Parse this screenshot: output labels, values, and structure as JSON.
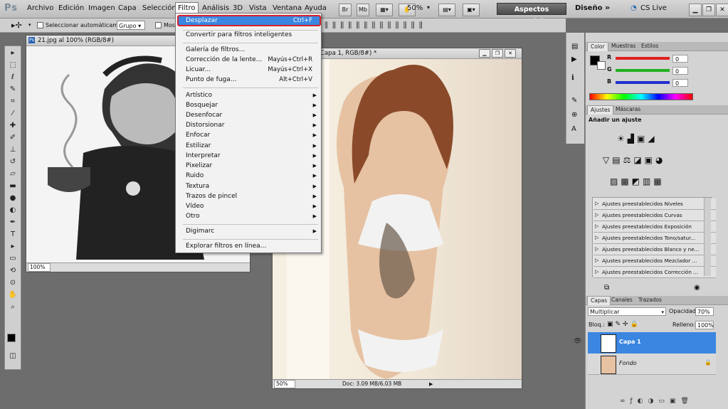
{
  "app": {
    "logo": "Ps"
  },
  "menubar": {
    "items": [
      "Archivo",
      "Edición",
      "Imagen",
      "Capa",
      "Selección",
      "Filtro",
      "Análisis",
      "3D",
      "Vista",
      "Ventana",
      "Ayuda"
    ],
    "zoom": "50%",
    "workspace": "Aspectos esenciales",
    "design": "Diseño",
    "cslive": "CS Live"
  },
  "options": {
    "auto_select_label": "Seleccionar automáticamente:",
    "auto_select_value": "Grupo",
    "show_label": "Mos"
  },
  "filter_menu": {
    "top": {
      "label": "Desplazar",
      "shortcut": "Ctrl+F"
    },
    "smart": "Convertir para filtros inteligentes",
    "group1": [
      {
        "label": "Galería de filtros...",
        "shortcut": ""
      },
      {
        "label": "Corrección de la lente...",
        "shortcut": "Mayús+Ctrl+R"
      },
      {
        "label": "Licuar...",
        "shortcut": "Mayús+Ctrl+X"
      },
      {
        "label": "Punto de fuga...",
        "shortcut": "Alt+Ctrl+V"
      }
    ],
    "submenus": [
      "Artístico",
      "Bosquejar",
      "Desenfocar",
      "Distorsionar",
      "Enfocar",
      "Estilizar",
      "Interpretar",
      "Pixelizar",
      "Ruido",
      "Textura",
      "Trazos de pincel",
      "Vídeo",
      "Otro"
    ],
    "digimarc": "Digimarc",
    "online": "Explorar filtros en línea..."
  },
  "doc1": {
    "title": "21.jpg al 100% (RGB/8#)",
    "zoom": "100%"
  },
  "doc2": {
    "title": "jpg al 50% (Capa 1, RGB/8#) *",
    "zoom": "50%",
    "status": "Doc: 3.09 MB/6.03 MB"
  },
  "color_panel": {
    "tabs": [
      "Color",
      "Muestras",
      "Estilos"
    ],
    "channels": [
      {
        "name": "R",
        "value": "0",
        "color": "#e02020"
      },
      {
        "name": "G",
        "value": "0",
        "color": "#20b020"
      },
      {
        "name": "B",
        "value": "0",
        "color": "#2030d0"
      }
    ]
  },
  "adjust_panel": {
    "tabs": [
      "Ajustes",
      "Máscaras"
    ],
    "title": "Añadir un ajuste",
    "presets": [
      "Ajustes preestablecidos Niveles",
      "Ajustes preestablecidos Curvas",
      "Ajustes preestablecidos Exposición",
      "Ajustes preestablecidos Tono/satur...",
      "Ajustes preestablecidos Blanco y ne...",
      "Ajustes preestablecidos Mezclador ...",
      "Ajustes preestablecidos Corrección ..."
    ]
  },
  "layers_panel": {
    "tabs": [
      "Capas",
      "Canales",
      "Trazados"
    ],
    "blend_mode": "Multiplicar",
    "opacity_label": "Opacidad:",
    "opacity": "70%",
    "lock_label": "Bloq.:",
    "fill_label": "Relleno:",
    "fill": "100%",
    "layers": [
      {
        "name": "Capa 1",
        "selected": true
      },
      {
        "name": "Fondo",
        "selected": false
      }
    ]
  }
}
